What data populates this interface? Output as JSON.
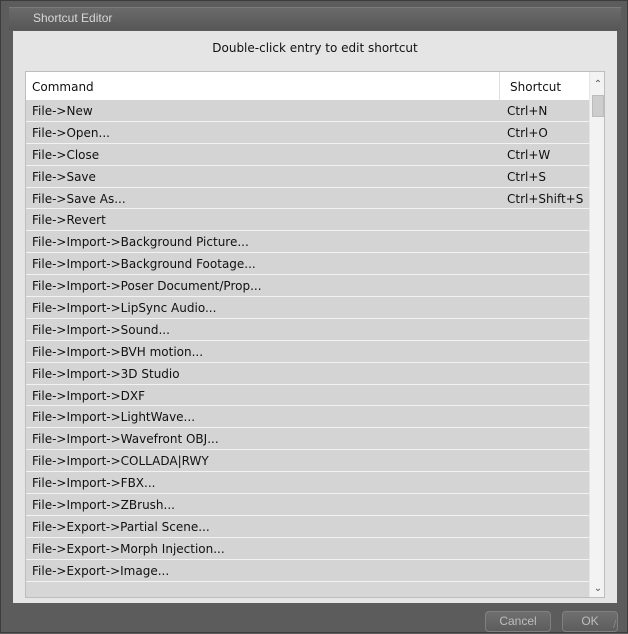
{
  "window": {
    "title": "Shortcut Editor"
  },
  "instruction": "Double-click entry to edit shortcut",
  "table": {
    "headers": {
      "command": "Command",
      "shortcut": "Shortcut"
    },
    "rows": [
      {
        "command": "File->New",
        "shortcut": "Ctrl+N"
      },
      {
        "command": "File->Open...",
        "shortcut": "Ctrl+O"
      },
      {
        "command": "File->Close",
        "shortcut": "Ctrl+W"
      },
      {
        "command": "File->Save",
        "shortcut": "Ctrl+S"
      },
      {
        "command": "File->Save As...",
        "shortcut": "Ctrl+Shift+S"
      },
      {
        "command": "File->Revert",
        "shortcut": ""
      },
      {
        "command": "File->Import->Background Picture...",
        "shortcut": ""
      },
      {
        "command": "File->Import->Background Footage...",
        "shortcut": ""
      },
      {
        "command": "File->Import->Poser Document/Prop...",
        "shortcut": ""
      },
      {
        "command": "File->Import->LipSync Audio...",
        "shortcut": ""
      },
      {
        "command": "File->Import->Sound...",
        "shortcut": ""
      },
      {
        "command": "File->Import->BVH motion...",
        "shortcut": ""
      },
      {
        "command": "File->Import->3D Studio",
        "shortcut": ""
      },
      {
        "command": "File->Import->DXF",
        "shortcut": ""
      },
      {
        "command": "File->Import->LightWave...",
        "shortcut": ""
      },
      {
        "command": "File->Import->Wavefront OBJ...",
        "shortcut": ""
      },
      {
        "command": "File->Import->COLLADA|RWY",
        "shortcut": ""
      },
      {
        "command": "File->Import->FBX...",
        "shortcut": ""
      },
      {
        "command": "File->Import->ZBrush...",
        "shortcut": ""
      },
      {
        "command": "File->Export->Partial Scene...",
        "shortcut": ""
      },
      {
        "command": "File->Export->Morph Injection...",
        "shortcut": ""
      },
      {
        "command": "File->Export->Image...",
        "shortcut": ""
      }
    ]
  },
  "scrollbar": {
    "up_icon": "chevron-up-icon",
    "down_icon": "chevron-down-icon"
  },
  "buttons": {
    "cancel": "Cancel",
    "ok": "OK"
  }
}
